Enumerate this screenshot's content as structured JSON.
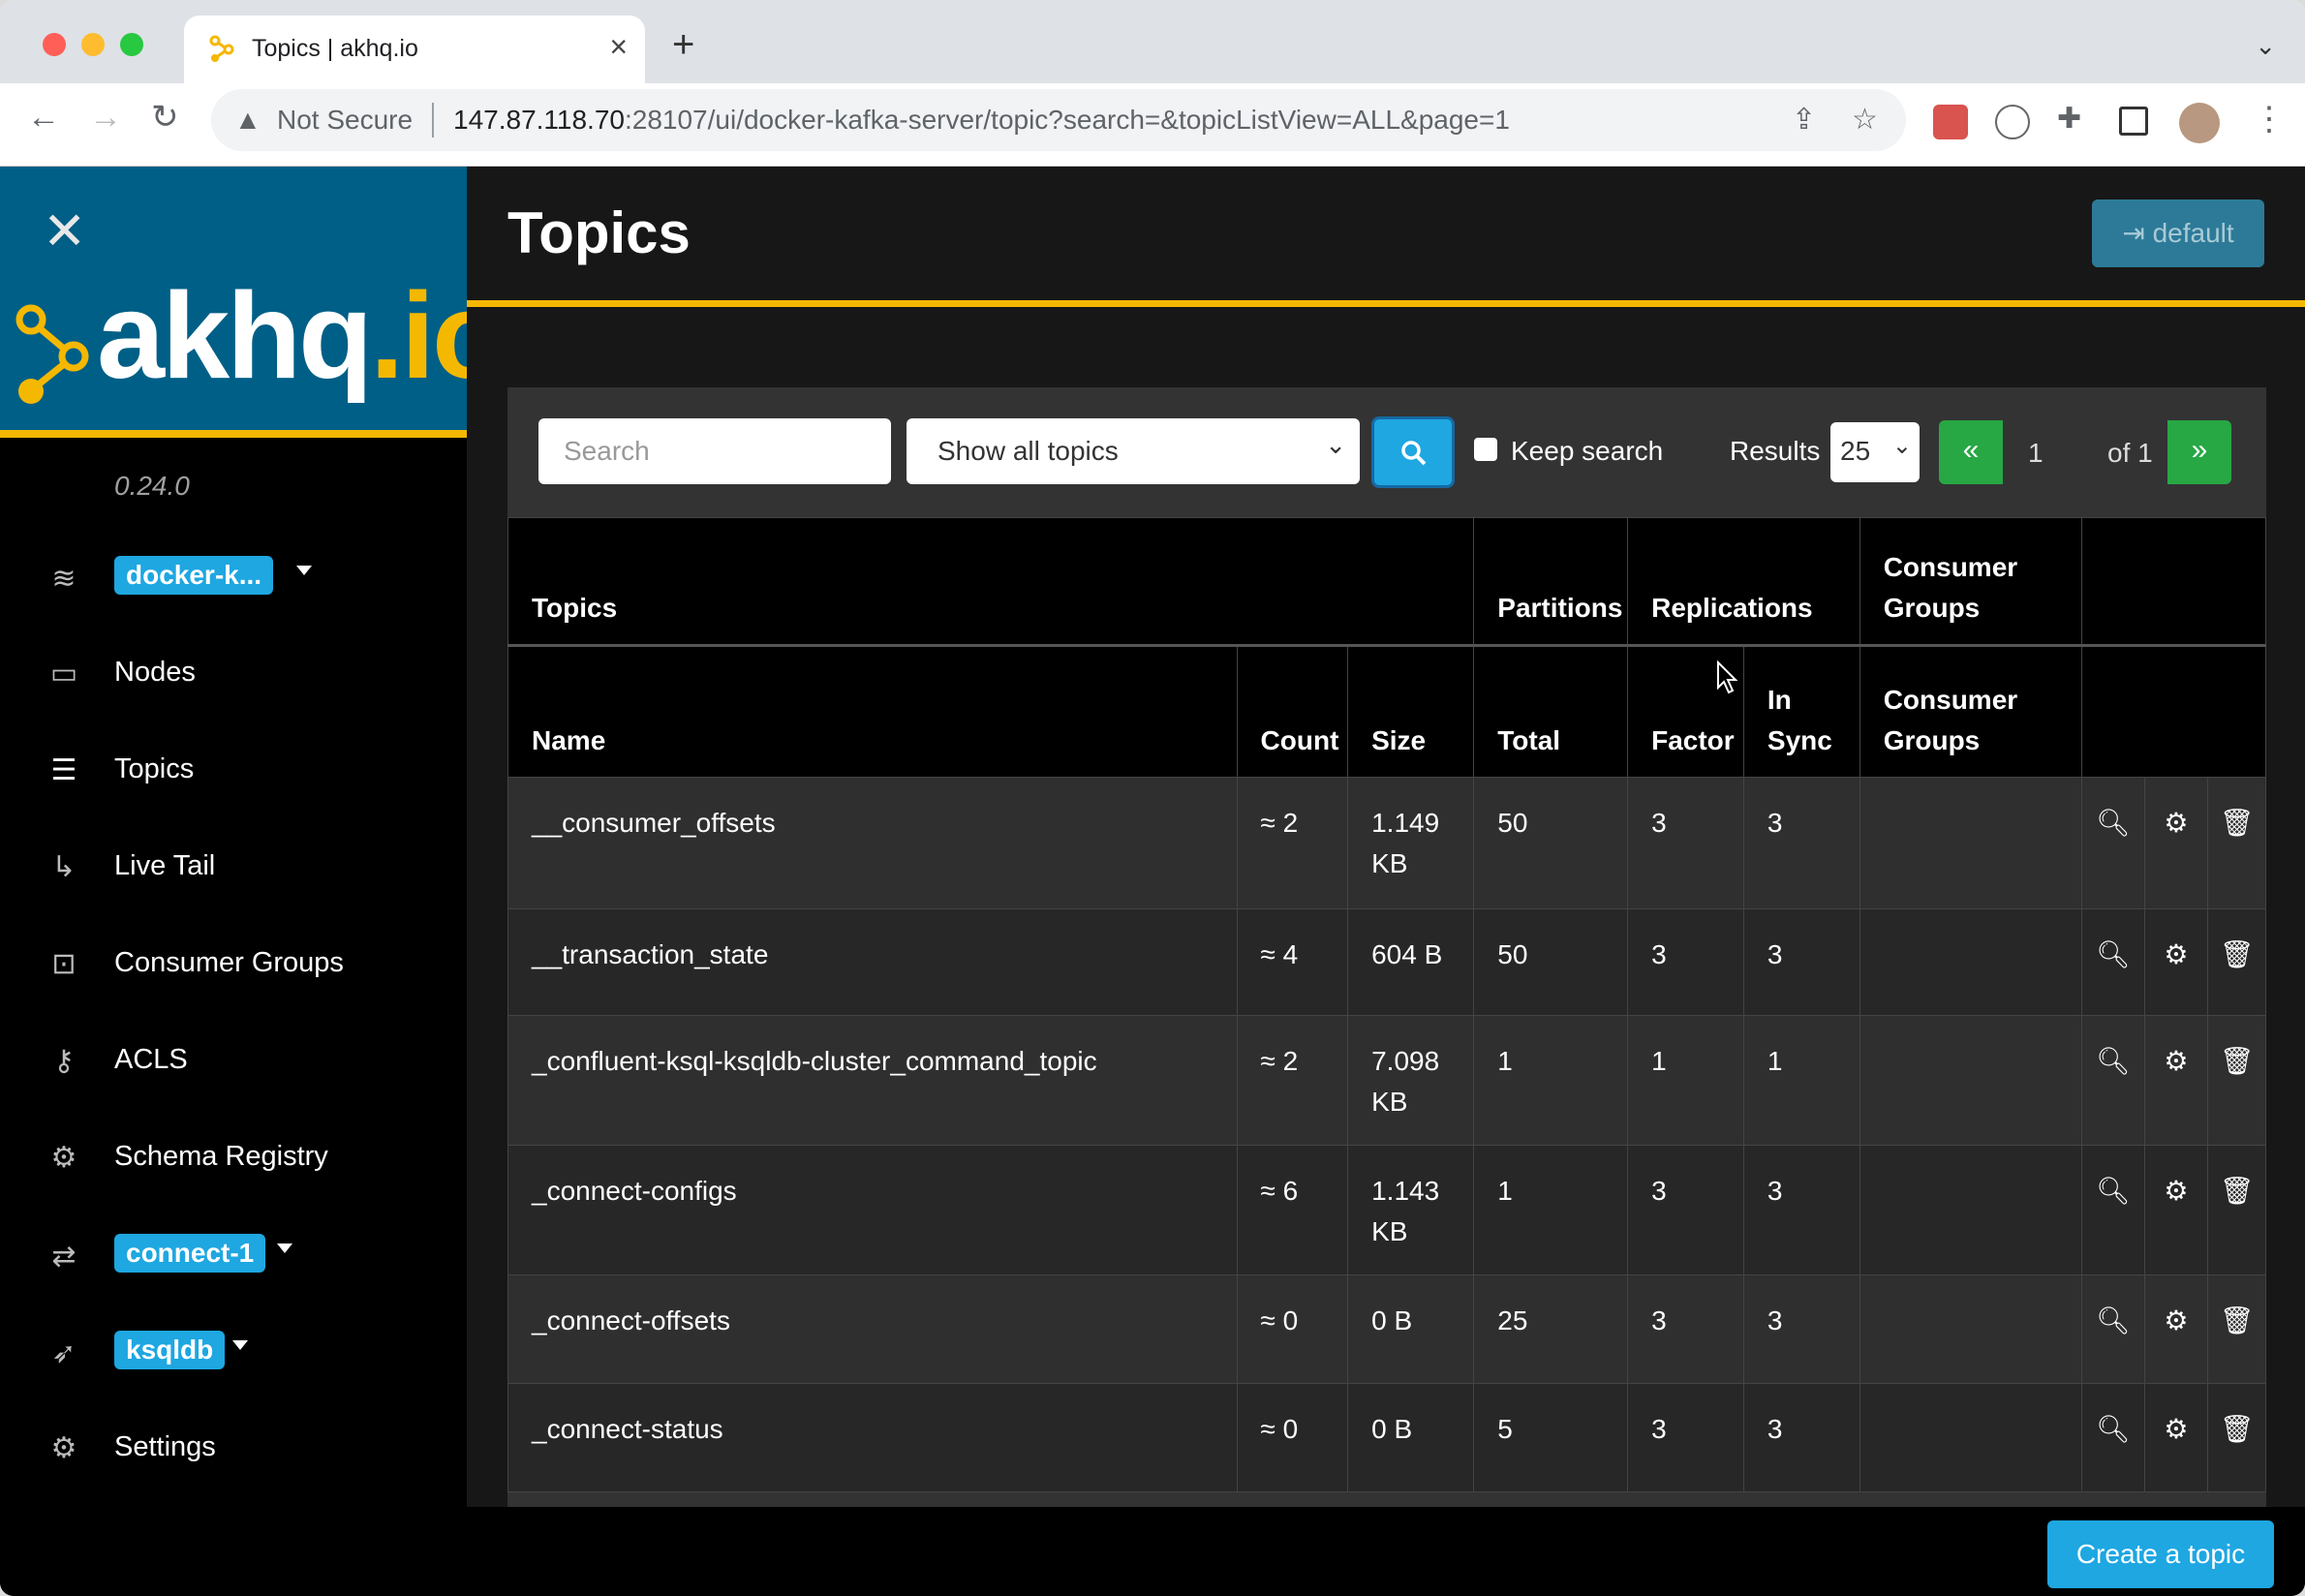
{
  "browser": {
    "tab_title": "Topics | akhq.io",
    "not_secure": "Not Secure",
    "url_host": "147.87.118.70",
    "url_rest": ":28107/ui/docker-kafka-server/topic?search=&topicListView=ALL&page=1"
  },
  "sidebar": {
    "logo_main": "akhq",
    "logo_io": ".io",
    "version": "0.24.0",
    "items": [
      {
        "label": "docker-k...",
        "icon": "database-icon",
        "badge": true
      },
      {
        "label": "Nodes",
        "icon": "laptop-icon",
        "badge": false
      },
      {
        "label": "Topics",
        "icon": "list-icon",
        "badge": false
      },
      {
        "label": "Live Tail",
        "icon": "level-down-icon",
        "badge": false
      },
      {
        "label": "Consumer Groups",
        "icon": "object-group-icon",
        "badge": false
      },
      {
        "label": "ACLS",
        "icon": "key-icon",
        "badge": false
      },
      {
        "label": "Schema Registry",
        "icon": "cogs-icon",
        "badge": false
      },
      {
        "label": "connect-1",
        "icon": "exchange-icon",
        "badge": true
      },
      {
        "label": "ksqldb",
        "icon": "rocket-icon",
        "badge": true
      },
      {
        "label": "Settings",
        "icon": "gear-icon",
        "badge": false
      }
    ]
  },
  "header": {
    "title": "Topics",
    "login_label": "default"
  },
  "filters": {
    "search_placeholder": "Search",
    "view_select": "Show all topics",
    "keep_search": "Keep search",
    "results_label": "Results",
    "results_value": "25",
    "page_prev": "«",
    "page_current": "1",
    "page_of": "of 1",
    "page_next": "»"
  },
  "table": {
    "group_headers": [
      "Topics",
      "Partitions",
      "Replications",
      "Consumer Groups"
    ],
    "columns": [
      "Name",
      "Count",
      "Size",
      "Total",
      "Factor",
      "In Sync",
      "Consumer Groups"
    ],
    "rows": [
      {
        "name": "__consumer_offsets",
        "count": "≈ 2",
        "size": "1.149 KB",
        "total": "50",
        "factor": "3",
        "in_sync": "3",
        "groups": ""
      },
      {
        "name": "__transaction_state",
        "count": "≈ 4",
        "size": "604 B",
        "total": "50",
        "factor": "3",
        "in_sync": "3",
        "groups": ""
      },
      {
        "name": "_confluent-ksql-ksqldb-cluster_command_topic",
        "count": "≈ 2",
        "size": "7.098 KB",
        "total": "1",
        "factor": "1",
        "in_sync": "1",
        "groups": ""
      },
      {
        "name": "_connect-configs",
        "count": "≈ 6",
        "size": "1.143 KB",
        "total": "1",
        "factor": "3",
        "in_sync": "3",
        "groups": ""
      },
      {
        "name": "_connect-offsets",
        "count": "≈ 0",
        "size": "0 B",
        "total": "25",
        "factor": "3",
        "in_sync": "3",
        "groups": ""
      },
      {
        "name": "_connect-status",
        "count": "≈ 0",
        "size": "0 B",
        "total": "5",
        "factor": "3",
        "in_sync": "3",
        "groups": ""
      }
    ]
  },
  "footer": {
    "create_label": "Create a topic"
  }
}
